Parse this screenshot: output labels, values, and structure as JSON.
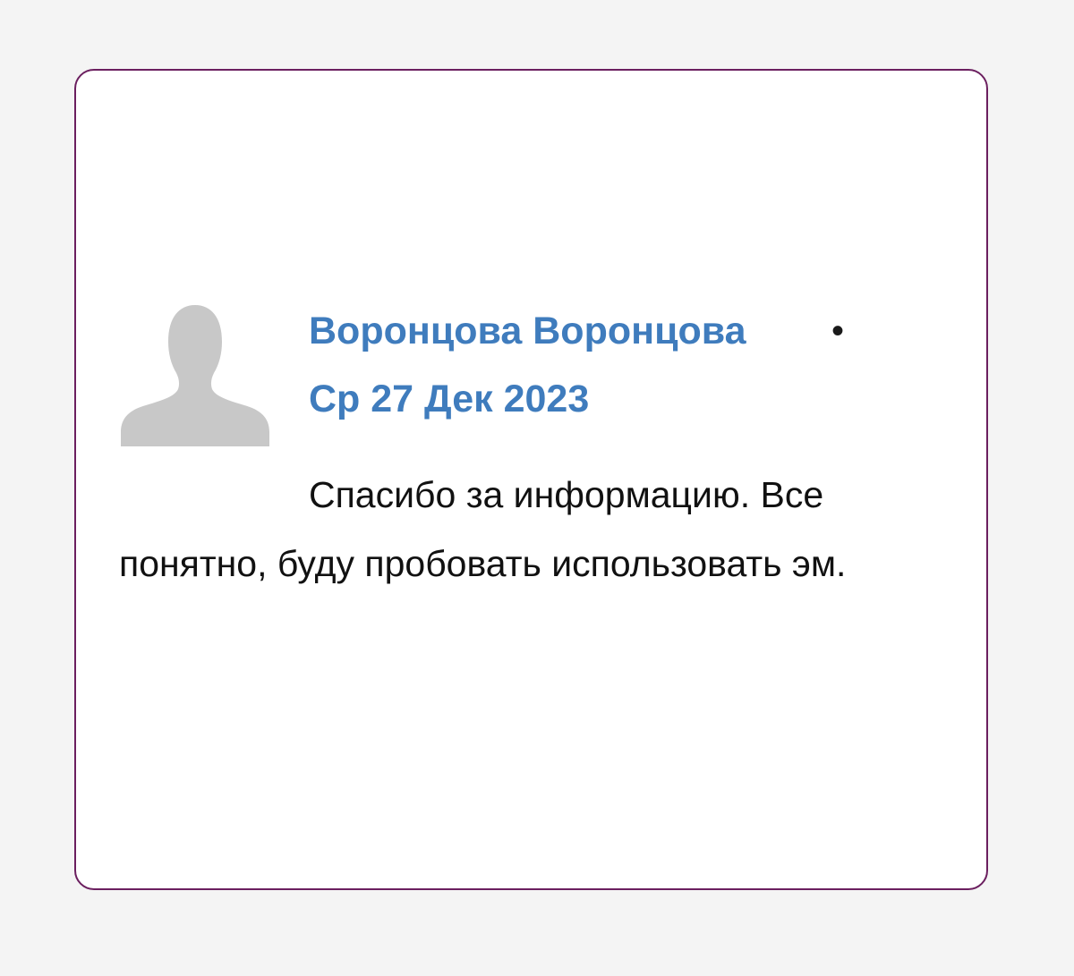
{
  "comment": {
    "author": "Воронцова Воронцова",
    "separator": "•",
    "date": "Ср 27 Дек 2023",
    "text": "Спасибо за информацию. Все понятно, буду пробовать использовать эм.",
    "avatar_icon": "default-user-avatar-icon"
  },
  "colors": {
    "author_link": "#3f7cbd",
    "card_border": "#6b1f5f",
    "avatar": "#c8c8c8"
  }
}
